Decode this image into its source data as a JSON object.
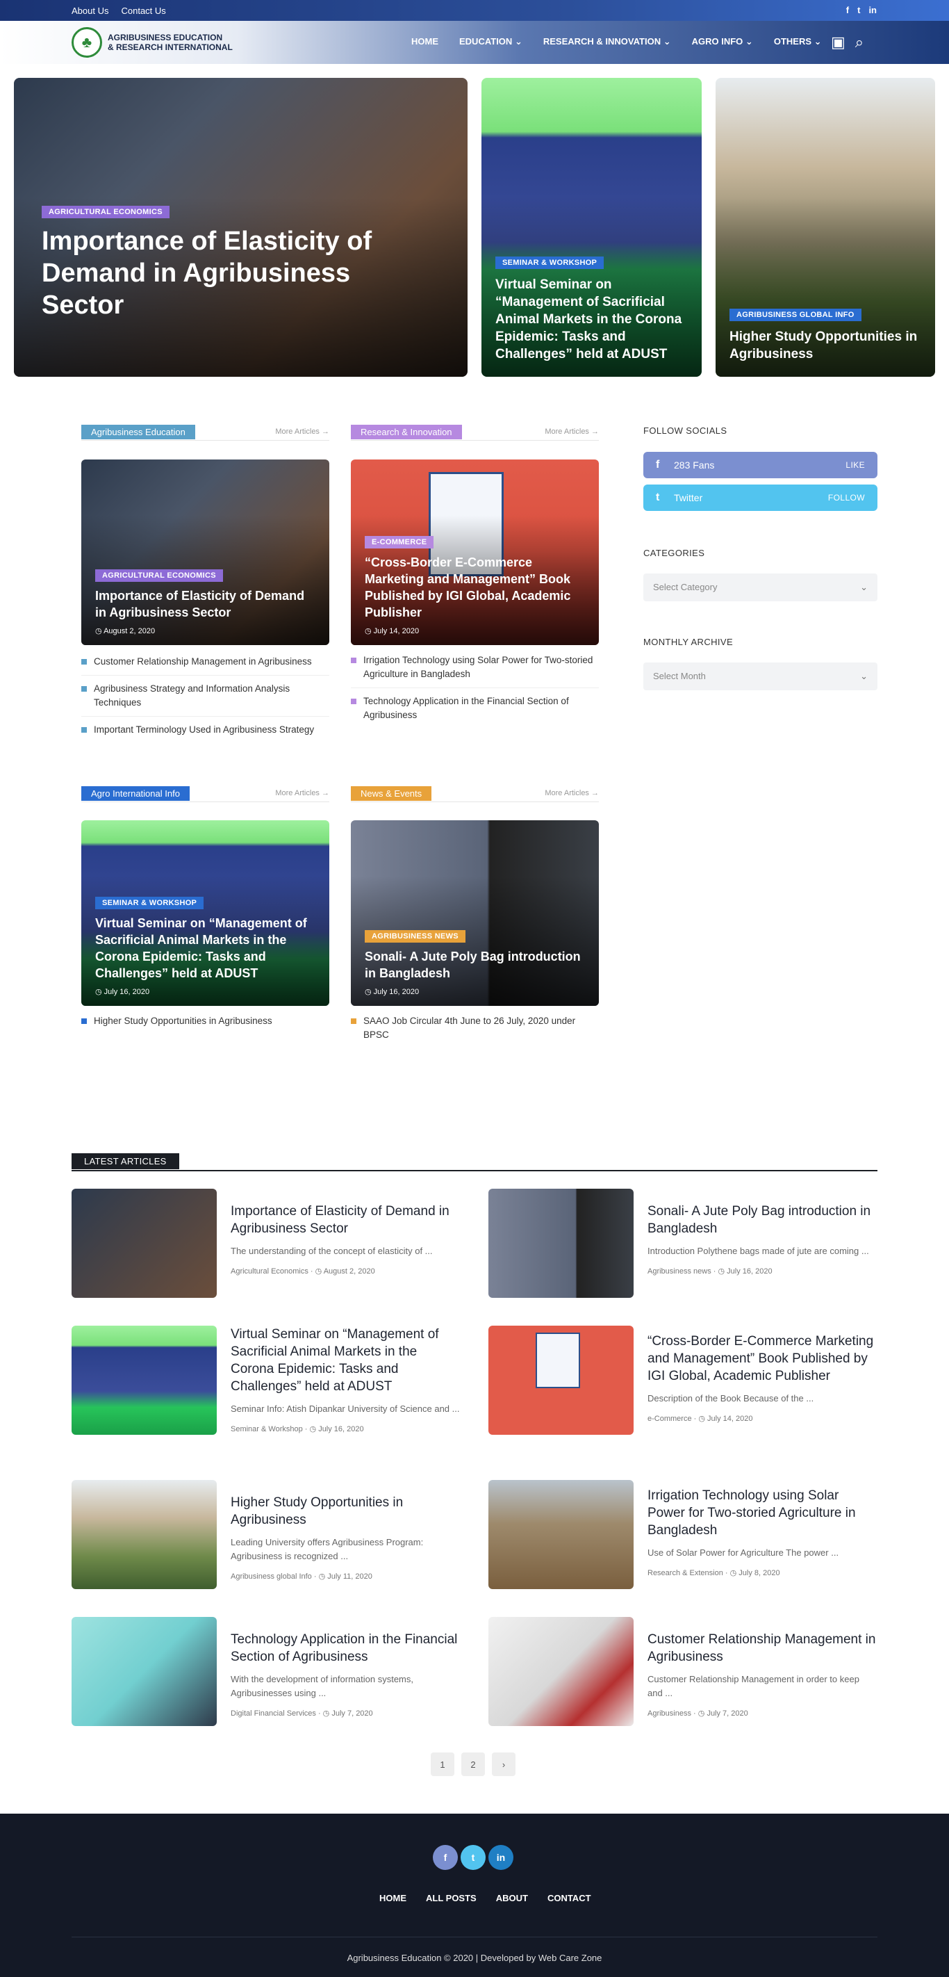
{
  "topbar": {
    "about": "About Us",
    "contact": "Contact Us",
    "social_icons": [
      "facebook-icon",
      "twitter-icon",
      "linkedin-icon"
    ]
  },
  "brand": {
    "line1": "AGRIBUSINESS EDUCATION",
    "line2": "& RESEARCH INTERNATIONAL"
  },
  "nav": {
    "home": "HOME",
    "education": "EDUCATION",
    "research": "RESEARCH & INNOVATION",
    "agro": "AGRO INFO",
    "others": "OTHERS"
  },
  "hero": [
    {
      "badge": "AGRICULTURAL ECONOMICS",
      "title": "Importance of Elasticity of Demand in Agribusiness Sector"
    },
    {
      "badge": "SEMINAR & WORKSHOP",
      "title": "Virtual Seminar on “Management of Sacrificial Animal Markets in the Corona Epidemic: Tasks and Challenges” held at ADUST"
    },
    {
      "badge": "AGRIBUSINESS GLOBAL INFO",
      "title": "Higher Study Opportunities in Agribusiness"
    }
  ],
  "sections": {
    "more_label": "More Articles →",
    "edu": {
      "tag": "Agribusiness Education",
      "card": {
        "badge": "AGRICULTURAL ECONOMICS",
        "title": "Importance of Elasticity of Demand in Agribusiness Sector",
        "date": "August 2, 2020"
      },
      "list": [
        "Customer Relationship Management in Agribusiness",
        "Agribusiness Strategy and Information Analysis Techniques",
        "Important Terminology Used in Agribusiness Strategy"
      ]
    },
    "research": {
      "tag": "Research & Innovation",
      "card": {
        "badge": "E-COMMERCE",
        "title": "“Cross-Border E-Commerce Marketing and Management” Book Published by IGI Global, Academic Publisher",
        "date": "July 14, 2020"
      },
      "list": [
        "Irrigation Technology using Solar Power for Two-storied Agriculture in Bangladesh",
        "Technology Application in the Financial Section of Agribusiness"
      ]
    },
    "agro": {
      "tag": "Agro International Info",
      "card": {
        "badge": "SEMINAR & WORKSHOP",
        "title": "Virtual Seminar on “Management of Sacrificial Animal Markets in the Corona Epidemic: Tasks and Challenges” held at ADUST",
        "date": "July 16, 2020"
      },
      "list": [
        "Higher Study Opportunities in Agribusiness"
      ]
    },
    "news": {
      "tag": "News & Events",
      "card": {
        "badge": "AGRIBUSINESS NEWS",
        "title": "Sonali- A Jute Poly Bag introduction in Bangladesh",
        "date": "July 16, 2020"
      },
      "list": [
        "SAAO Job Circular 4th June to 26 July, 2020 under BPSC"
      ]
    }
  },
  "sidebar": {
    "follow_title": "FOLLOW SOCIALS",
    "fb": {
      "label": "283 Fans",
      "action": "LIKE"
    },
    "tw": {
      "label": "Twitter",
      "action": "FOLLOW"
    },
    "categories_title": "CATEGORIES",
    "categories_placeholder": "Select Category",
    "archive_title": "MONTHLY ARCHIVE",
    "archive_placeholder": "Select Month"
  },
  "latest": {
    "title": "LATEST ARTICLES",
    "items": [
      {
        "title": "Importance of Elasticity of Demand in Agribusiness Sector",
        "excerpt": "The understanding of the concept of elasticity of ...",
        "category": "Agricultural Economics",
        "date": "August 2, 2020"
      },
      {
        "title": "Sonali- A Jute Poly Bag introduction in Bangladesh",
        "excerpt": "Introduction Polythene bags made of jute are coming ...",
        "category": "Agribusiness news",
        "date": "July 16, 2020"
      },
      {
        "title": "Virtual Seminar on “Management of Sacrificial Animal Markets in the Corona Epidemic: Tasks and Challenges” held at ADUST",
        "excerpt": "Seminar Info:  Atish Dipankar University of Science and ...",
        "category": "Seminar & Workshop",
        "date": "July 16, 2020"
      },
      {
        "title": "“Cross-Border E-Commerce Marketing and Management” Book Published by IGI Global, Academic Publisher",
        "excerpt": "Description of the Book  Because of the ...",
        "category": "e-Commerce",
        "date": "July 14, 2020"
      },
      {
        "title": "Higher Study Opportunities in Agribusiness",
        "excerpt": "Leading University offers Agribusiness Program: Agribusiness is recognized ...",
        "category": "Agribusiness global Info",
        "date": "July 11, 2020"
      },
      {
        "title": "Irrigation Technology using Solar Power for Two-storied Agriculture in Bangladesh",
        "excerpt": "Use of Solar Power for Agriculture The power ...",
        "category": "Research & Extension",
        "date": "July 8, 2020"
      },
      {
        "title": "Technology Application in the Financial Section of Agribusiness",
        "excerpt": "With the development of information systems, Agribusinesses using ...",
        "category": "Digital Financial Services",
        "date": "July 7, 2020"
      },
      {
        "title": "Customer Relationship Management in Agribusiness",
        "excerpt": "Customer Relationship Management in order to keep and ...",
        "category": "Agribusiness",
        "date": "July 7, 2020"
      }
    ]
  },
  "pager": {
    "p1": "1",
    "p2": "2",
    "next": "›"
  },
  "footer": {
    "menu": [
      "HOME",
      "ALL POSTS",
      "ABOUT",
      "CONTACT"
    ],
    "copy": "Agribusiness Education © 2020 | Developed by Web Care Zone"
  },
  "colors": {
    "primary": "#1c3a7a",
    "edu_tag": "#5aa0c8",
    "research_tag": "#b689e0",
    "agro_tag": "#2a6dd1",
    "news_tag": "#e8a23a",
    "footer_bg": "#141926"
  }
}
